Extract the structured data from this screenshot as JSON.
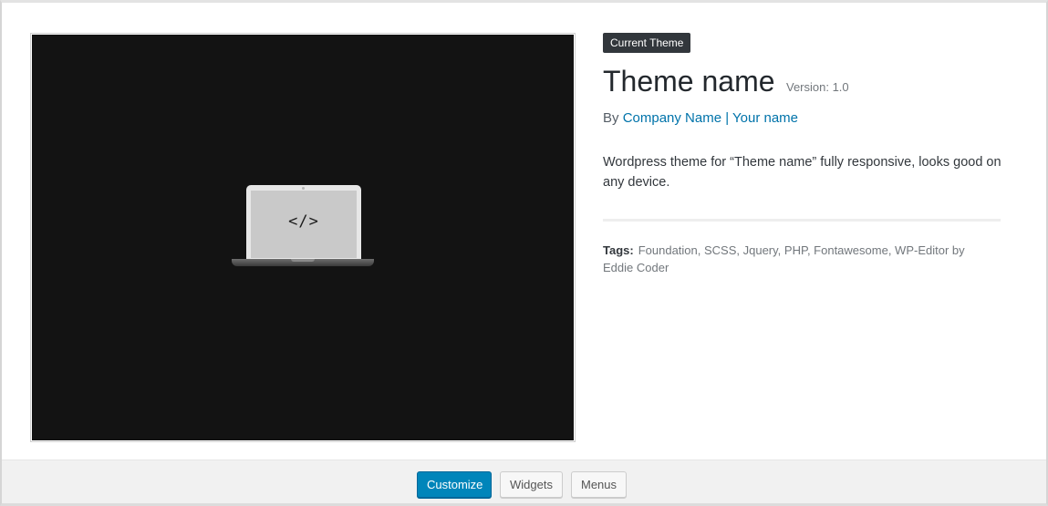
{
  "theme": {
    "badge": "Current Theme",
    "name": "Theme name",
    "version_label": "Version: 1.0",
    "author_prefix": "By",
    "author_name": "Company Name | Your name",
    "description": "Wordpress theme for “Theme name” fully responsive, looks good on any device.",
    "tags_label": "Tags:",
    "tags_value": "Foundation, SCSS, Jquery, PHP, Fontawesome, WP-Editor by Eddie Coder",
    "screenshot": {
      "glyph": "</>"
    }
  },
  "actions": {
    "customize": "Customize",
    "widgets": "Widgets",
    "menus": "Menus"
  },
  "colors": {
    "accent": "#0085ba",
    "link": "#0073aa",
    "badge_bg": "#32373c",
    "screenshot_bg": "#131313"
  },
  "icons": {
    "screenshot_placeholder": "laptop-code-icon"
  }
}
